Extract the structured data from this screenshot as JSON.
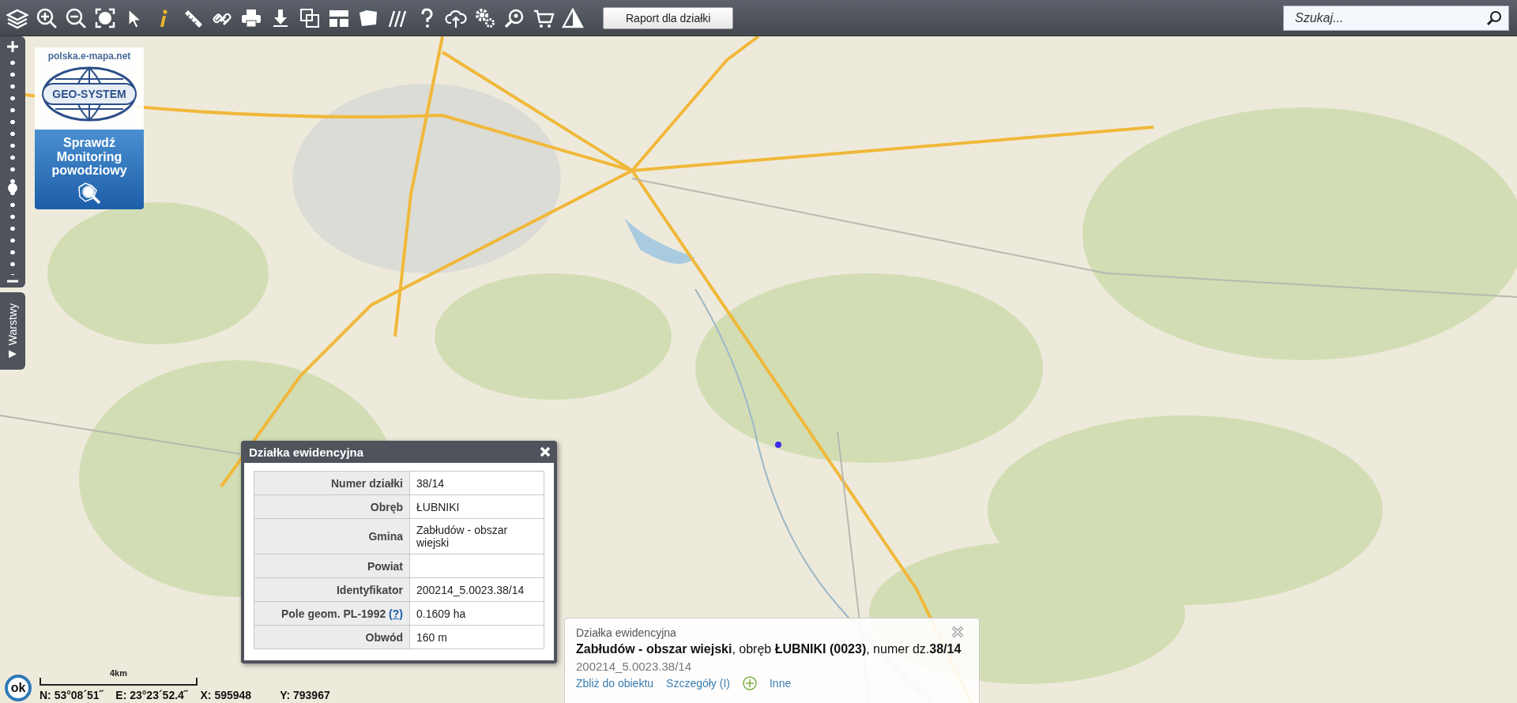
{
  "toolbar": {
    "report_button": "Raport dla działki",
    "search": {
      "placeholder": "Szukaj..."
    }
  },
  "zoom_slider": {
    "level": 0.4
  },
  "layers_tab": {
    "label": "Warstwy"
  },
  "logo_panel": {
    "site": "polska.e-mapa.net",
    "logo_text": "GEO-SYSTEM",
    "flood_button": "Sprawdź Monitoring powodziowy"
  },
  "parcel_popup": {
    "title": "Działka ewidencyjna",
    "rows": [
      {
        "label": "Numer działki",
        "value": "38/14"
      },
      {
        "label": "Obręb",
        "value": "ŁUBNIKI"
      },
      {
        "label": "Gmina",
        "value": "Zabłudów - obszar wiejski"
      },
      {
        "label": "Powiat"
      },
      {
        "label": "Identyfikator",
        "value": "200214_5.0023.38/14"
      },
      {
        "label": "Pole geom. PL-1992",
        "help_link": "(?)",
        "value": "0.1609 ha"
      },
      {
        "label": "Obwód",
        "value": "160 m"
      }
    ]
  },
  "info_panel": {
    "title": "Działka ewidencyjna",
    "summary": "**Zabłudów - obszar wiejski**, obręb **ŁUBNIKI (0023)**, numer dz.**38/14**",
    "identifier": "200214_5.0023.38/14",
    "links": [
      {
        "label": "Zbliż do obiektu"
      },
      {
        "label": "Szczegóły (I)"
      },
      {
        "label": "Inne"
      }
    ]
  },
  "status_bar": {
    "ok_button": "ok",
    "scale": "4km",
    "coordinates": [
      "N: 53°08´51˝",
      "E: 23°23´52.4˝",
      "X: 595948",
      "Y: 793967"
    ]
  }
}
